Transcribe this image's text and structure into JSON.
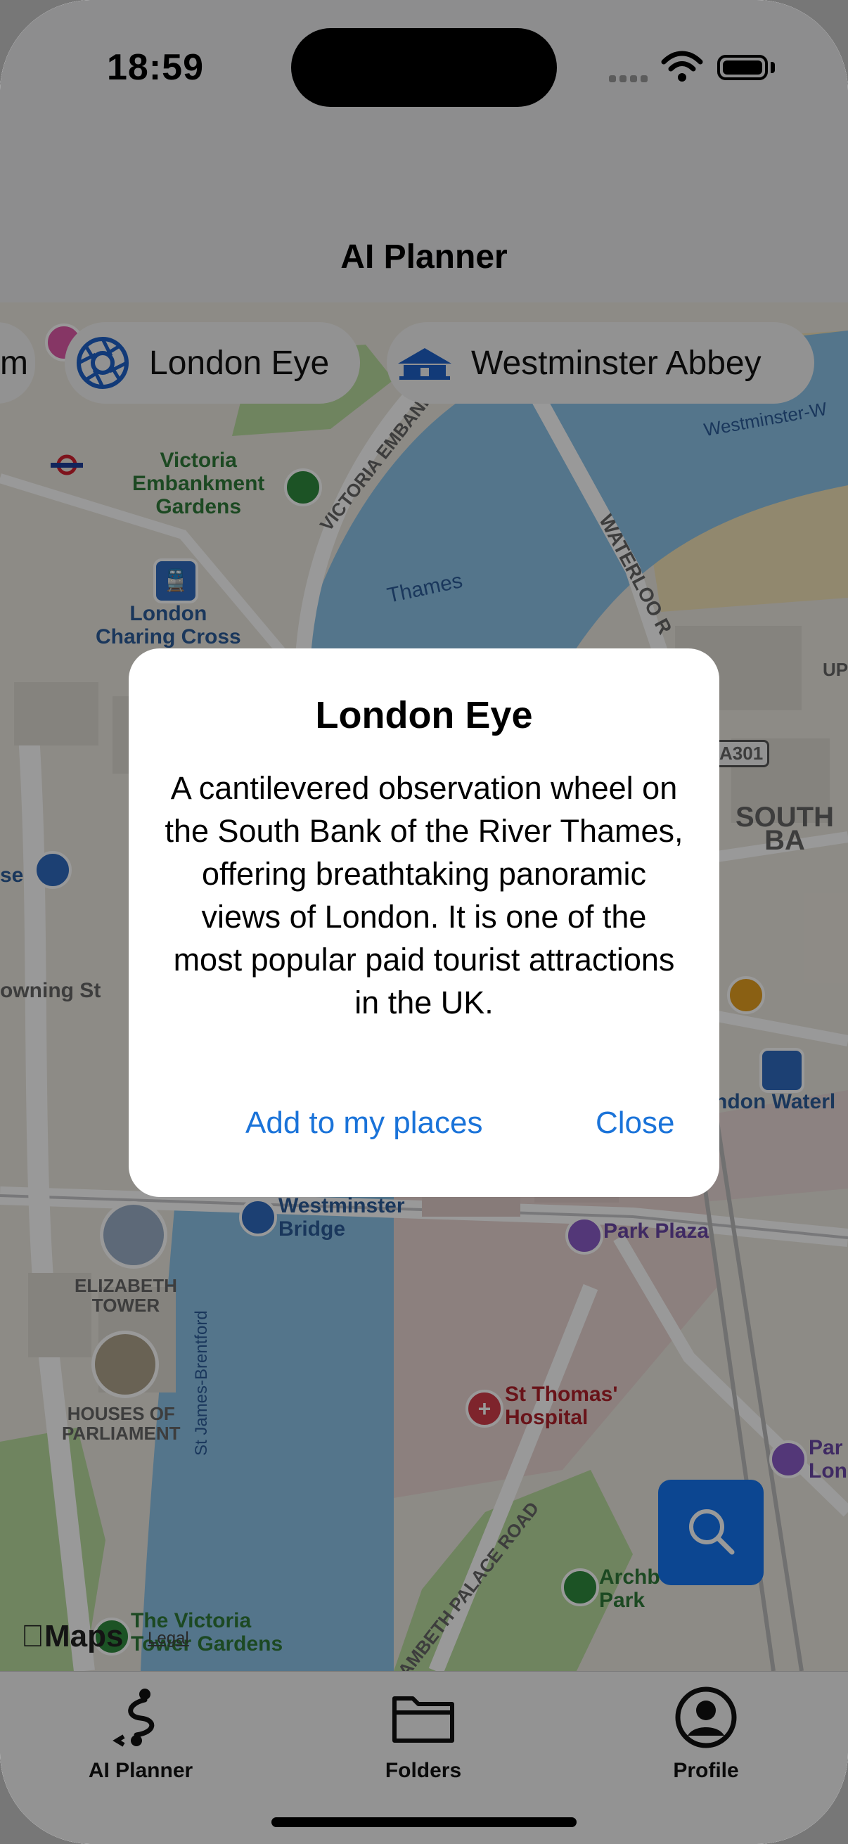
{
  "status_bar": {
    "time": "18:59"
  },
  "nav": {
    "title": "AI Planner"
  },
  "chips": [
    {
      "label": "London Eye",
      "icon": "ferris-wheel-icon"
    },
    {
      "label": "Westminster Abbey",
      "icon": "landmark-icon"
    }
  ],
  "map": {
    "labels": {
      "victoria_embankment_gardens": "Victoria\nEmbankment\nGardens",
      "victoria_embankment": "VICTORIA EMBANKMENT",
      "thames": "Thames",
      "waterloo": "WATERLOO R",
      "westminster_w": "Westminster-W",
      "london_charing_cross": "London\nCharing Cross",
      "a301": "A301",
      "south_bank": "SOUTH BA",
      "downing_st": "owning St",
      "london_waterloo": "ndon Waterl",
      "westminster_bridge": "Westminster\nBridge",
      "park_plaza": "Park Plaza",
      "elizabeth_tower": "ELIZABETH\nTOWER",
      "houses_of_parliament": "HOUSES OF\nPARLIAMENT",
      "st_james_brentford": "St James-Brentford",
      "st_thomas_hospital": "St Thomas'\nHospital",
      "lambeth_palace_road": "LAMBETH PALACE ROAD",
      "archbishops_park": "Archb\nPark",
      "victoria_tower_gardens": "The Victoria\nTower Gardens",
      "park_lon": "Par\nLon",
      "se": "se",
      "up": "UP",
      "m": "m"
    },
    "attribution": "Maps",
    "legal": "Legal"
  },
  "alert": {
    "title": "London Eye",
    "message": "A cantilevered observation wheel on the South Bank of the River Thames, offering breathtaking panoramic views of London. It is one of the most popular paid tourist attractions in the UK.",
    "primary_action": "Add to my places",
    "secondary_action": "Close"
  },
  "tabs": [
    {
      "label": "AI Planner",
      "icon": "route-icon"
    },
    {
      "label": "Folders",
      "icon": "folder-icon"
    },
    {
      "label": "Profile",
      "icon": "person-circle-icon"
    }
  ],
  "colors": {
    "accent": "#1a73d9",
    "fab": "#1576f2",
    "water": "#8cc3e8",
    "park": "#b9dc9f"
  }
}
